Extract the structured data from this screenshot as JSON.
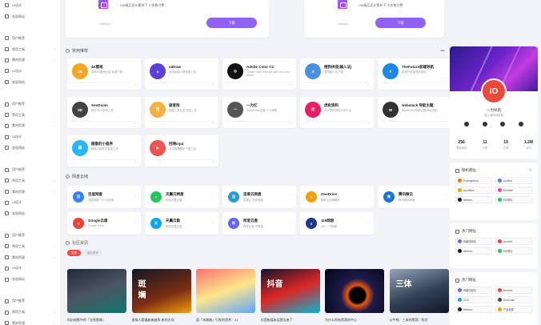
{
  "sidebar": {
    "items": [
      {
        "label": "UI设计",
        "icon": "ui-icon",
        "chev": false
      },
      {
        "label": "发现网站",
        "icon": "discover-icon",
        "chev": false
      },
      {
        "label": "",
        "icon": "",
        "chev": false
      },
      {
        "label": "用户推荐",
        "icon": "user-icon",
        "chev": false
      },
      {
        "label": "常用工具",
        "icon": "tools-icon",
        "chev": true
      },
      {
        "label": "素材资源",
        "icon": "resource-icon",
        "chev": true
      },
      {
        "label": "UI设计",
        "icon": "ui-icon",
        "chev": false
      },
      {
        "label": "发现网站",
        "icon": "discover-icon",
        "chev": false
      },
      {
        "label": "",
        "icon": "",
        "chev": false
      },
      {
        "label": "用户推荐",
        "icon": "user-icon",
        "chev": false
      },
      {
        "label": "常用工具",
        "icon": "tools-icon",
        "chev": true
      },
      {
        "label": "素材资源",
        "icon": "resource-icon",
        "chev": true
      },
      {
        "label": "UI设计",
        "icon": "ui-icon",
        "chev": false
      },
      {
        "label": "发现网站",
        "icon": "discover-icon",
        "chev": false
      },
      {
        "label": "",
        "icon": "",
        "chev": false
      },
      {
        "label": "用户推荐",
        "icon": "user-icon",
        "chev": false
      },
      {
        "label": "常用工具",
        "icon": "tools-icon",
        "chev": true
      },
      {
        "label": "素材资源",
        "icon": "resource-icon",
        "chev": true
      },
      {
        "label": "UI设计",
        "icon": "ui-icon",
        "chev": false
      },
      {
        "label": "发现网站",
        "icon": "discover-icon",
        "chev": false
      },
      {
        "label": "",
        "icon": "",
        "chev": false
      },
      {
        "label": "用户推荐",
        "icon": "user-icon",
        "chev": false
      },
      {
        "label": "常用工具",
        "icon": "tools-icon",
        "chev": true
      },
      {
        "label": "素材资源",
        "icon": "resource-icon",
        "chev": true
      },
      {
        "label": "UI设计",
        "icon": "ui-icon",
        "chev": false
      },
      {
        "label": "发现网站",
        "icon": "discover-icon",
        "chev": false
      },
      {
        "label": "",
        "icon": "",
        "chev": false
      },
      {
        "label": "用户推荐",
        "icon": "user-icon",
        "chev": false
      },
      {
        "label": "常用工具",
        "icon": "tools-icon",
        "chev": true
      },
      {
        "label": "素材资源",
        "icon": "resource-icon",
        "chev": true
      }
    ]
  },
  "promos": [
    {
      "desc": "UI8精品设计素材下 大多数付费",
      "meta": "UIdesign",
      "button": "下载"
    },
    {
      "desc": "UI8精品设计素材下 大多数付费",
      "meta": "uidesign",
      "button": "下载"
    }
  ],
  "sections": {
    "common": "常用推荐",
    "cloud": "网盘云储",
    "community": "社区资讯"
  },
  "cards": [
    {
      "name": "4K壁纸",
      "desc": "高清4K壁纸大全 免费下载",
      "color": "#f5a623",
      "glyph": "4K"
    },
    {
      "name": "uiDraw",
      "desc": "在线绘制UI原型图工具",
      "color": "#5b3fd6",
      "glyph": "u"
    },
    {
      "name": "Adobe Color CC",
      "desc": "Create color schemes with the color wheel",
      "color": "#111111",
      "glyph": "◎"
    },
    {
      "name": "搜狗拼音(输入法)",
      "desc": "搜狗输入法下载",
      "color": "#4a90e2",
      "glyph": "S"
    },
    {
      "name": "TheFuture前端导航",
      "desc": "前端开发者导航网站",
      "color": "#1e88e5",
      "glyph": "F"
    },
    {
      "name": "SeoDoam",
      "desc": "站长SEO查询工具",
      "color": "#444444",
      "glyph": "SE"
    },
    {
      "name": "极客狗",
      "desc": "极客工具大全 在线工具",
      "color": "#f5b041",
      "glyph": "狗"
    },
    {
      "name": "一为忆",
      "desc": "WordPress主题 个人博客",
      "color": "#555555",
      "glyph": "一"
    },
    {
      "name": "虎彩资料",
      "desc": "设计素材资料分享平台",
      "color": "#e91e63",
      "glyph": "虎"
    },
    {
      "name": "webstack 导航主题",
      "desc": "WordPress导航主题 网址导航",
      "color": "#333333",
      "glyph": "W"
    },
    {
      "name": "随意的小程序",
      "desc": "微信小程序开发者工具",
      "color": "#29b6f6",
      "glyph": "随"
    },
    {
      "name": "回溯mp4",
      "desc": "在线视频解析下载工具",
      "color": "#ef5350",
      "glyph": "▶"
    }
  ],
  "clouds": [
    {
      "name": "百度网盘",
      "desc": "百度网盘 个人云存储",
      "color": "#3b82f6",
      "glyph": "百"
    },
    {
      "name": "天翼云网盘",
      "desc": "电信天翼云盘",
      "color": "#22c55e",
      "glyph": "T"
    },
    {
      "name": "坚果云网盘",
      "desc": "坚果云 同步网盘",
      "color": "#2b9bd6",
      "glyph": "坚"
    },
    {
      "name": "OneDrive",
      "desc": "微软云存储服务",
      "color": "#f59e0b",
      "glyph": "O"
    },
    {
      "name": "腾讯微云",
      "desc": "腾讯微云网盘",
      "color": "#1976d2",
      "glyph": "微"
    },
    {
      "name": "Google云盘",
      "desc": "Google Drive",
      "color": "#ea4335",
      "glyph": "G"
    },
    {
      "name": "天翼云盘",
      "desc": "电信天翼云盘",
      "color": "#0ea5e9",
      "glyph": "天"
    },
    {
      "name": "阿里云盘",
      "desc": "阿里云盘 不限速",
      "color": "#6366f1",
      "glyph": "阿"
    },
    {
      "name": "115网盘",
      "desc": "115 一个网盘",
      "color": "#1e3a8a",
      "glyph": "5"
    }
  ],
  "tabs": [
    "热榜",
    "站长资讯"
  ],
  "news": [
    {
      "caption": "科幻电影中的「全息影像」",
      "bg": "linear-gradient(160deg,#1f2937,#4b5563 50%,#0f766e)"
    },
    {
      "caption": "虚拟人赛道越来越多 新的方向",
      "bg": "linear-gradient(160deg,#111827,#7c2d12 60%,#f59e0b)"
    },
    {
      "caption": "盘「冰墩墩」引发的思考：21",
      "bg": "linear-gradient(160deg,#f87171,#fde68a 50%,#60a5fa)"
    },
    {
      "caption": "抖音新媒体运营法来了",
      "bg": "linear-gradient(160deg,#0f172a,#dc2626 50%,#06b6d4)"
    },
    {
      "caption": "为什么所有黑洞的中心",
      "bg": "radial-gradient(circle at 55% 60%,#000 18%,#ea580c 24%,#1e1b4b 40%,#020617)"
    },
    {
      "caption": "从牛顿、三体到黑洞：科学",
      "bg": "linear-gradient(160deg,#94a3b8,#334155 55%,#0f172a)"
    }
  ],
  "news_titles": [
    "斑",
    "斓",
    "抖音",
    "三体"
  ],
  "profile": {
    "name": "一为导航",
    "bio": "设计师网址导航",
    "avatar_text": "IO",
    "stats": [
      {
        "value": "256",
        "label": "收录网址"
      },
      {
        "value": "11",
        "label": "分类"
      },
      {
        "value": "19",
        "label": "文章"
      },
      {
        "value": "1.2M",
        "label": "访问"
      }
    ]
  },
  "random_sites": {
    "title": "随机网址",
    "items": [
      {
        "label": "Packageboot",
        "color": "#f97316"
      },
      {
        "label": "cooltext",
        "color": "#3b82f6"
      },
      {
        "label": "cloudflare",
        "color": "#f59e0b"
      },
      {
        "label": "Dribbble",
        "color": "#ec4899"
      },
      {
        "label": "Medium",
        "color": "#111827"
      },
      {
        "label": "500照片",
        "color": "#22c55e"
      }
    ]
  },
  "hot_sites": {
    "title": "热门网址",
    "items": [
      {
        "label": "有趣的网站",
        "color": "#6366f1"
      },
      {
        "label": "Iconfont",
        "color": "#ef4444"
      },
      {
        "label": "Medium",
        "color": "#111827"
      },
      {
        "label": "500照片",
        "color": "#22c55e"
      }
    ]
  },
  "hot_sites2": {
    "title": "热门网址",
    "items": [
      {
        "label": "有趣的网站",
        "color": "#6366f1"
      },
      {
        "label": "Iconfont",
        "color": "#ef4444"
      },
      {
        "label": "CDS",
        "color": "#0ea5e9"
      },
      {
        "label": "SeoDoam",
        "color": "#444444"
      },
      {
        "label": "Medium",
        "color": "#111827"
      },
      {
        "label": "产品经理",
        "color": "#f59e0b"
      }
    ]
  }
}
